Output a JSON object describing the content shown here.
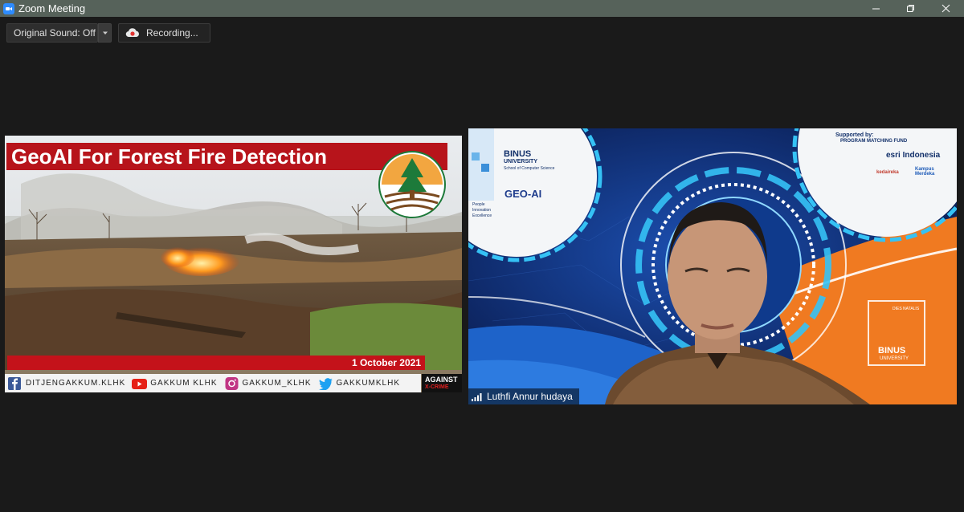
{
  "window": {
    "title": "Zoom Meeting"
  },
  "toolbar": {
    "original_sound_label": "Original Sound: Off",
    "recording_label": "Recording..."
  },
  "shared_screen": {
    "headline": "GeoAI For Forest Fire Detection",
    "date": "1 October 2021",
    "social": [
      {
        "icon": "facebook-icon",
        "handle": "DITJENGAKKUM.KLHK"
      },
      {
        "icon": "youtube-icon",
        "handle": "GAKKUM KLHK"
      },
      {
        "icon": "instagram-icon",
        "handle": "GAKKUM_KLHK"
      },
      {
        "icon": "twitter-icon",
        "handle": "GAKKUMKLHK"
      }
    ],
    "badge": {
      "line1": "AGAINST",
      "line2": "X-CRIME"
    }
  },
  "participant": {
    "name": "Luthfi Annur hudaya",
    "background": {
      "binus_title": "BINUS",
      "binus_sub": "UNIVERSITY",
      "binus_school": "School of Computer Science",
      "geoai": "GEO-AI",
      "tagline1": "People",
      "tagline2": "Innovation",
      "tagline3": "Excellence",
      "supported_by": "Supported by:",
      "program": "PROGRAM MATCHING FUND",
      "esri": "esri Indonesia",
      "kedaireka": "kedaireka",
      "kampus": "Kampus Merdeka",
      "natalis": "DIES NATALIS",
      "binus_bottom": "BINUS",
      "university_bottom": "UNIVERSITY"
    }
  },
  "colors": {
    "titlebar": "#56625a",
    "headline_red": "#b7141b",
    "zoom_blue": "#2d8cff",
    "orange_accent": "#f07a21"
  }
}
